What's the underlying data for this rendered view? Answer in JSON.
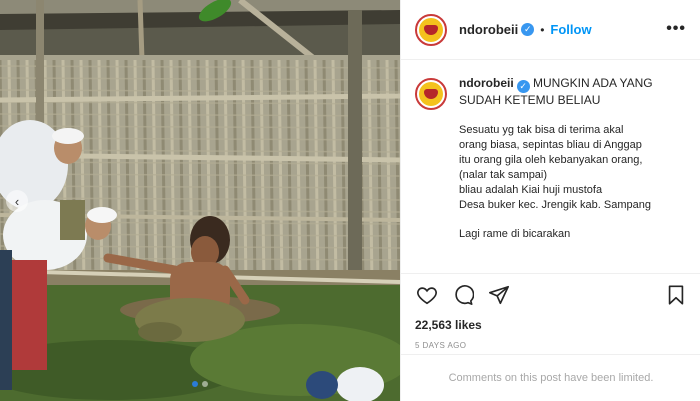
{
  "post": {
    "username": "ndorobeii",
    "verified": true,
    "separator": "•",
    "follow_label": "Follow",
    "more_label": "•••",
    "caption_title": "MUNGKIN ADA YANG SUDAH KETEMU BELIAU",
    "caption_lines": [
      "Sesuatu yg tak bisa di terima akal",
      "orang biasa, sepintas bliau di Anggap",
      "itu orang gila oleh kebanyakan orang,",
      "(nalar tak sampai)",
      "bliau adalah Kiai huji mustofa",
      "Desa buker kec. Jrengik kab. Sampang",
      "",
      "Lagi rame di bicarakan"
    ],
    "likes": "22,563 likes",
    "date": "5 days ago",
    "comments_disabled": "Comments on this post have been limited."
  },
  "photo": {
    "carousel_prev_icon": "chevron-left-icon",
    "carousel_count": 2,
    "carousel_active": 1
  },
  "icons": {
    "like": "heart-icon",
    "comment": "comment-icon",
    "share": "paper-plane-icon",
    "save": "bookmark-icon",
    "verified": "verified-badge-icon"
  },
  "colors": {
    "link": "#0095f6",
    "verified": "#3897f0",
    "muted": "#8e8e8e",
    "avatar_ring": "#c93a3a",
    "avatar_fill": "#f4c21d"
  }
}
